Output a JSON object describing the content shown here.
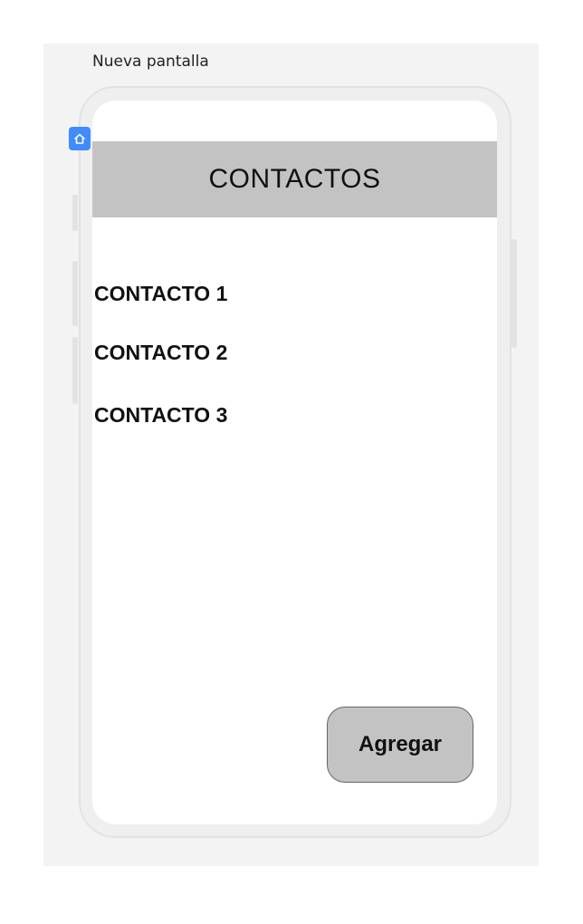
{
  "canvas": {
    "screen_label": "Nueva pantalla"
  },
  "icons": {
    "home": "home-icon"
  },
  "app": {
    "header_title": "CONTACTOS",
    "contacts": [
      {
        "name": "CONTACTO 1"
      },
      {
        "name": "CONTACTO 2"
      },
      {
        "name": "CONTACTO 3"
      }
    ],
    "add_button_label": "Agregar"
  }
}
